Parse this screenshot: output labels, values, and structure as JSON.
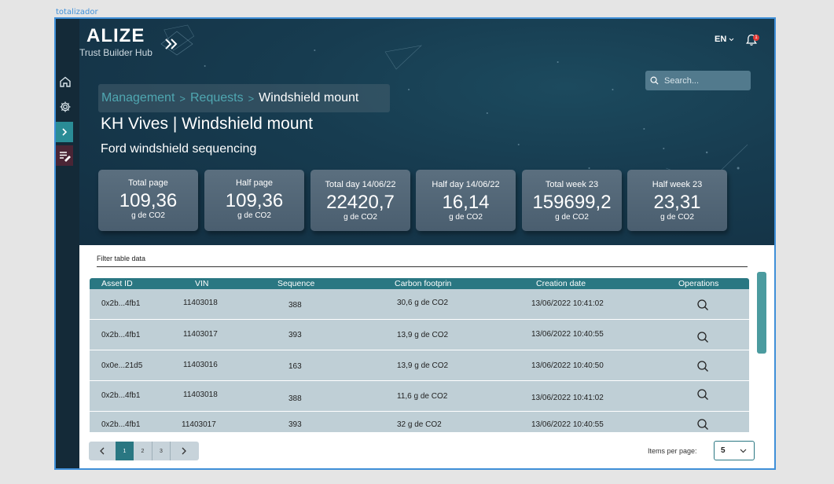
{
  "frame_label": "totalizador",
  "brand": {
    "name": "ALIZE",
    "subtitle": "Trust Builder Hub"
  },
  "header": {
    "language": "EN",
    "notification_count": "1"
  },
  "search": {
    "placeholder": "Search..."
  },
  "breadcrumb": {
    "items": [
      "Management",
      "Requests"
    ],
    "current": "Windshield mount"
  },
  "page": {
    "title": "KH Vives | Windshield mount",
    "subtitle": "Ford windshield sequencing"
  },
  "cards": [
    {
      "label": "Total page",
      "value": "109,36",
      "unit": "g de CO2"
    },
    {
      "label": "Half page",
      "value": "109,36",
      "unit": "g de CO2"
    },
    {
      "label": "Total day 14/06/22",
      "value": "22420,7",
      "unit": "g de CO2"
    },
    {
      "label": "Half day 14/06/22",
      "value": "16,14",
      "unit": "g de CO2"
    },
    {
      "label": "Total week 23",
      "value": "159699,2",
      "unit": "g de CO2"
    },
    {
      "label": "Half week 23",
      "value": "23,31",
      "unit": "g de CO2"
    }
  ],
  "filter": {
    "placeholder": "Filter table data"
  },
  "table": {
    "columns": [
      "Asset ID",
      "VIN",
      "Sequence",
      "Carbon footprin",
      "Creation date",
      "Operations"
    ],
    "rows": [
      [
        "0x2b...4fb1",
        "11403018",
        "388",
        "30,6 g de CO2",
        "13/06/2022 10:41:02"
      ],
      [
        "0x2b...4fb1",
        "11403017",
        "393",
        "13,9 g de CO2",
        "13/06/2022 10:40:55"
      ],
      [
        "0x0e...21d5",
        "11403016",
        "163",
        "13,9 g de CO2",
        "13/06/2022 10:40:50"
      ],
      [
        "0x2b...4fb1",
        "11403018",
        "388",
        "11,6 g de CO2",
        "13/06/2022 10:41:02"
      ],
      [
        "0x2b...4fb1",
        "11403017",
        "393",
        "32 g de CO2",
        "13/06/2022 10:40:55"
      ]
    ]
  },
  "pagination": {
    "pages": [
      "1",
      "2",
      "3"
    ],
    "active_page": "1",
    "items_per_page_label": "Items per page:",
    "items_per_page": "5"
  },
  "colors": {
    "hero": "#173c50",
    "accent": "#2a7782",
    "sidebar": "#142a38",
    "frame": "#3f8fd8"
  }
}
